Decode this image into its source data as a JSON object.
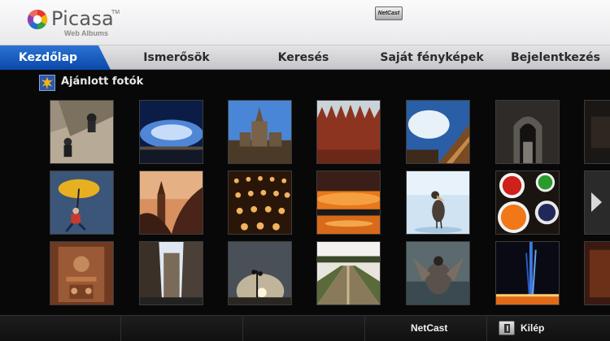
{
  "header": {
    "logo_name": "Picasa",
    "logo_tm": "TM",
    "logo_sub": "Web Albums"
  },
  "nav": {
    "items": [
      {
        "label": "Kezdőlap",
        "active": true
      },
      {
        "label": "Ismerősök",
        "active": false
      },
      {
        "label": "Keresés",
        "active": false
      },
      {
        "label": "Saját fényképek",
        "active": false
      },
      {
        "label": "Bejelentkezés",
        "active": false
      }
    ]
  },
  "section": {
    "title": "Ajánlott fotók",
    "icon": "featured-photos-icon"
  },
  "footer": {
    "netcast_badge": "NetCast",
    "netcast_label": "NetCast",
    "exit_label": "Kilép"
  },
  "colors": {
    "nav_active": "#1a5fc4",
    "background": "#080808"
  }
}
